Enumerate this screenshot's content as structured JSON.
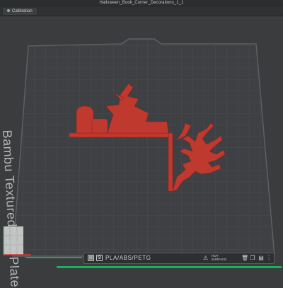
{
  "window": {
    "title": "Halloween_Book_Corner_Decorations_1_1"
  },
  "tabs": [
    {
      "label": "Calibration"
    }
  ],
  "plate": {
    "label": "Bambu Textured PEI Plate"
  },
  "toolbar": {
    "filament": "PLA/ABS/PETG",
    "surface_line1": "HOT",
    "surface_line2": "SURFACE"
  },
  "progress": {
    "fraction": 1.0
  },
  "colors": {
    "model": "#c0392f",
    "accent": "#17b25a",
    "plate": "#3e4043"
  }
}
